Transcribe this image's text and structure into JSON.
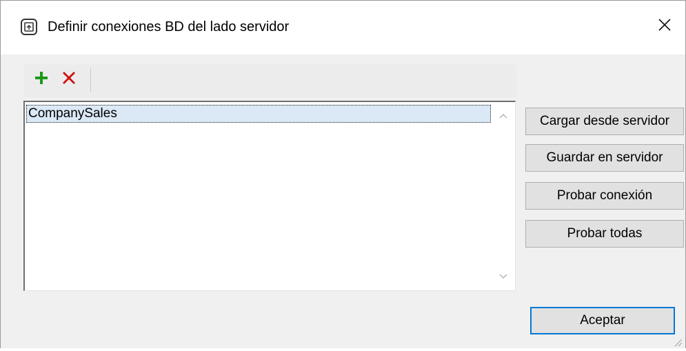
{
  "window": {
    "title": "Definir conexiones BD del lado servidor",
    "app_icon": "app-dialog-icon",
    "close_icon": "close-icon"
  },
  "toolbar": {
    "add_icon": "plus-icon",
    "add_color": "#1a9a1a",
    "delete_icon": "x-icon",
    "delete_color": "#d01010"
  },
  "connections": {
    "items": [
      "CompanySales"
    ],
    "selected_index": 0
  },
  "actions": {
    "load": "Cargar desde servidor",
    "save": "Guardar en servidor",
    "test": "Probar conexión",
    "test_all": "Probar todas"
  },
  "footer": {
    "ok": "Aceptar",
    "accent": "#0078d7"
  }
}
